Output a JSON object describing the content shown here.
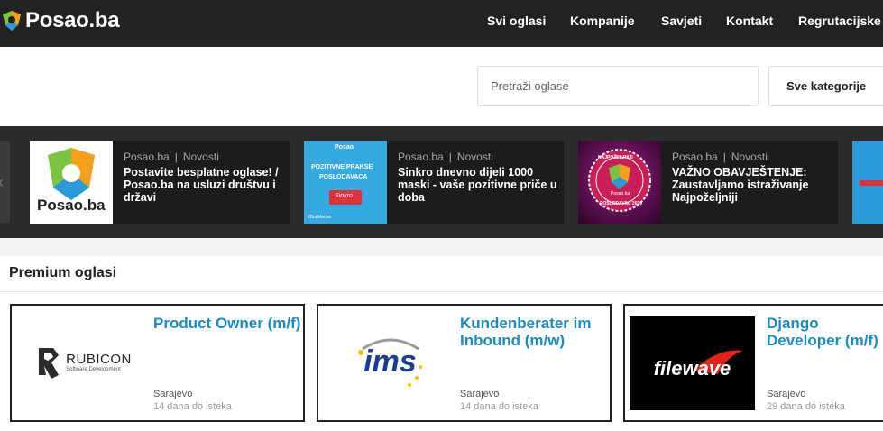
{
  "header": {
    "logo_text": "Posao.ba",
    "nav": [
      {
        "label": "Svi oglasi"
      },
      {
        "label": "Kompanije"
      },
      {
        "label": "Savjeti"
      },
      {
        "label": "Kontakt"
      },
      {
        "label": "Regrutacijske"
      }
    ]
  },
  "search": {
    "placeholder": "Pretraži oglase",
    "category_label": "Sve kategorije"
  },
  "news": [
    {
      "source": "Posao.ba",
      "category": "Novosti",
      "title": "Postavite besplatne oglase! / Posao.ba na usluzi društvu i državi",
      "thumb_text": "Posao.ba"
    },
    {
      "source": "Posao.ba",
      "category": "Novosti",
      "title": "Sinkro dnevno dijeli 1000 maski - vaše pozitivne priče u doba",
      "thumb_line1": "POZITIVNE PRAKSE",
      "thumb_line2": "POSLODAVACA",
      "thumb_brand": "Posao",
      "thumb_tag": "#BuđiJedan",
      "thumb_sinkro": "Sinkro"
    },
    {
      "source": "Posao.ba",
      "category": "Novosti",
      "title": "VAŽNO OBAVJEŠTENJE: Zaustavljamo istraživanje Najpoželjniji",
      "thumb_top": "NAJPOŽELJNIJI",
      "thumb_bottom": "POSLODAVAC 2020",
      "thumb_center": "Posao.ba"
    }
  ],
  "premium": {
    "title": "Premium oglasi",
    "jobs": [
      {
        "title": "Product Owner (m/f)",
        "city": "Sarajevo",
        "expiry": "14 dana do isteka",
        "logo_name": "RUBICON",
        "logo_sub": "Software Development"
      },
      {
        "title": "Kundenberater im Inbound (m/w)",
        "city": "Sarajevo",
        "expiry": "14 dana do isteka",
        "logo_name": "ims"
      },
      {
        "title": "Django Developer (m/f)",
        "city": "Sarajevo",
        "expiry": "29 dana do isteka",
        "logo_name": "filewave"
      }
    ]
  },
  "colors": {
    "header_bg": "#222222",
    "accent_blue": "#1a8cc2",
    "news_bg": "#2b2b2b"
  }
}
